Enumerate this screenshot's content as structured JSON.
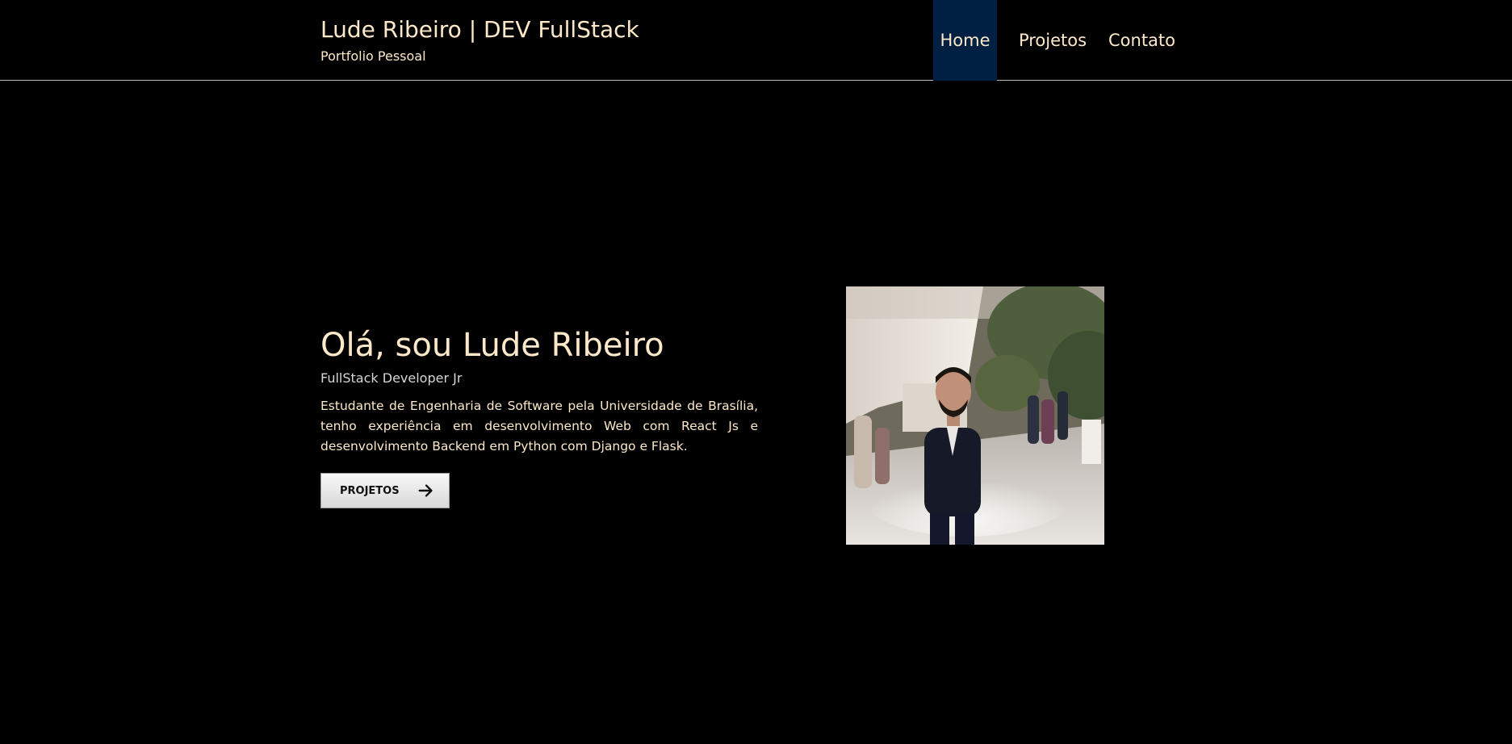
{
  "header": {
    "title": "Lude Ribeiro | DEV FullStack",
    "subtitle": "Portfolio Pessoal",
    "nav": {
      "home": "Home",
      "projetos": "Projetos",
      "contato": "Contato"
    },
    "active_nav": "Home"
  },
  "hero": {
    "title": "Olá, sou Lude Ribeiro",
    "role": "FullStack Developer Jr",
    "description": "Estudante de Engenharia de Software pela Universidade de Brasília, tenho experiência em desenvolvimento Web com React Js e desenvolvimento Backend em Python com Django e Flask.",
    "button_label": "PROJETOS",
    "button_icon": "arrow-right-icon"
  },
  "colors": {
    "background": "#000000",
    "text": "#fde9c9",
    "nav_active": "#002043"
  }
}
